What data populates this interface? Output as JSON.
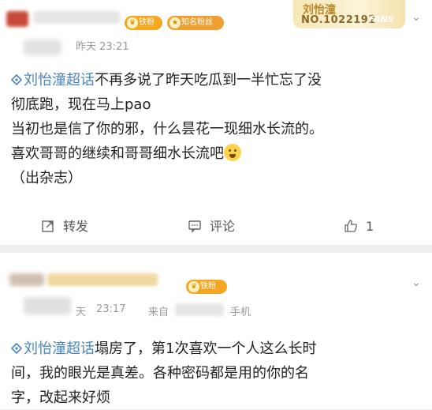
{
  "post1": {
    "badges": {
      "badge1": "铁粉",
      "badge2": "知名粉丝"
    },
    "fans_card": {
      "name": "刘怡潼",
      "number": "NO.1022192",
      "word": "FANS"
    },
    "time": "昨天 23:21",
    "topic": "刘怡潼超话",
    "lines": {
      "l1": "不再多说了昨天吃瓜到一半忙忘了没",
      "l2": "彻底跑，现在马上pao",
      "l3": "当初也是信了你的邪，什么昙花一现细水长流的。",
      "l4": "喜欢哥哥的继续和哥哥细水长流吧",
      "l5": "（出杂志）"
    },
    "actions": {
      "repost": "转发",
      "comment": "评论",
      "like_count": "1"
    }
  },
  "post2": {
    "badge": "铁粉",
    "time": "23:17",
    "time_prefix": "天",
    "from": "来自",
    "device": "手机",
    "topic": "刘怡潼超话",
    "lines": {
      "l1": "塌房了，第1次喜欢一个人这么长时",
      "l2": "间，我的眼光是真差。各种密码都是用的你的名",
      "l3": "字，改起来好烦"
    }
  },
  "colors": {
    "topic": "#4a84c2",
    "badge_iron": "#f5a623",
    "badge_famous": "#f0a030",
    "muted": "#999999"
  }
}
